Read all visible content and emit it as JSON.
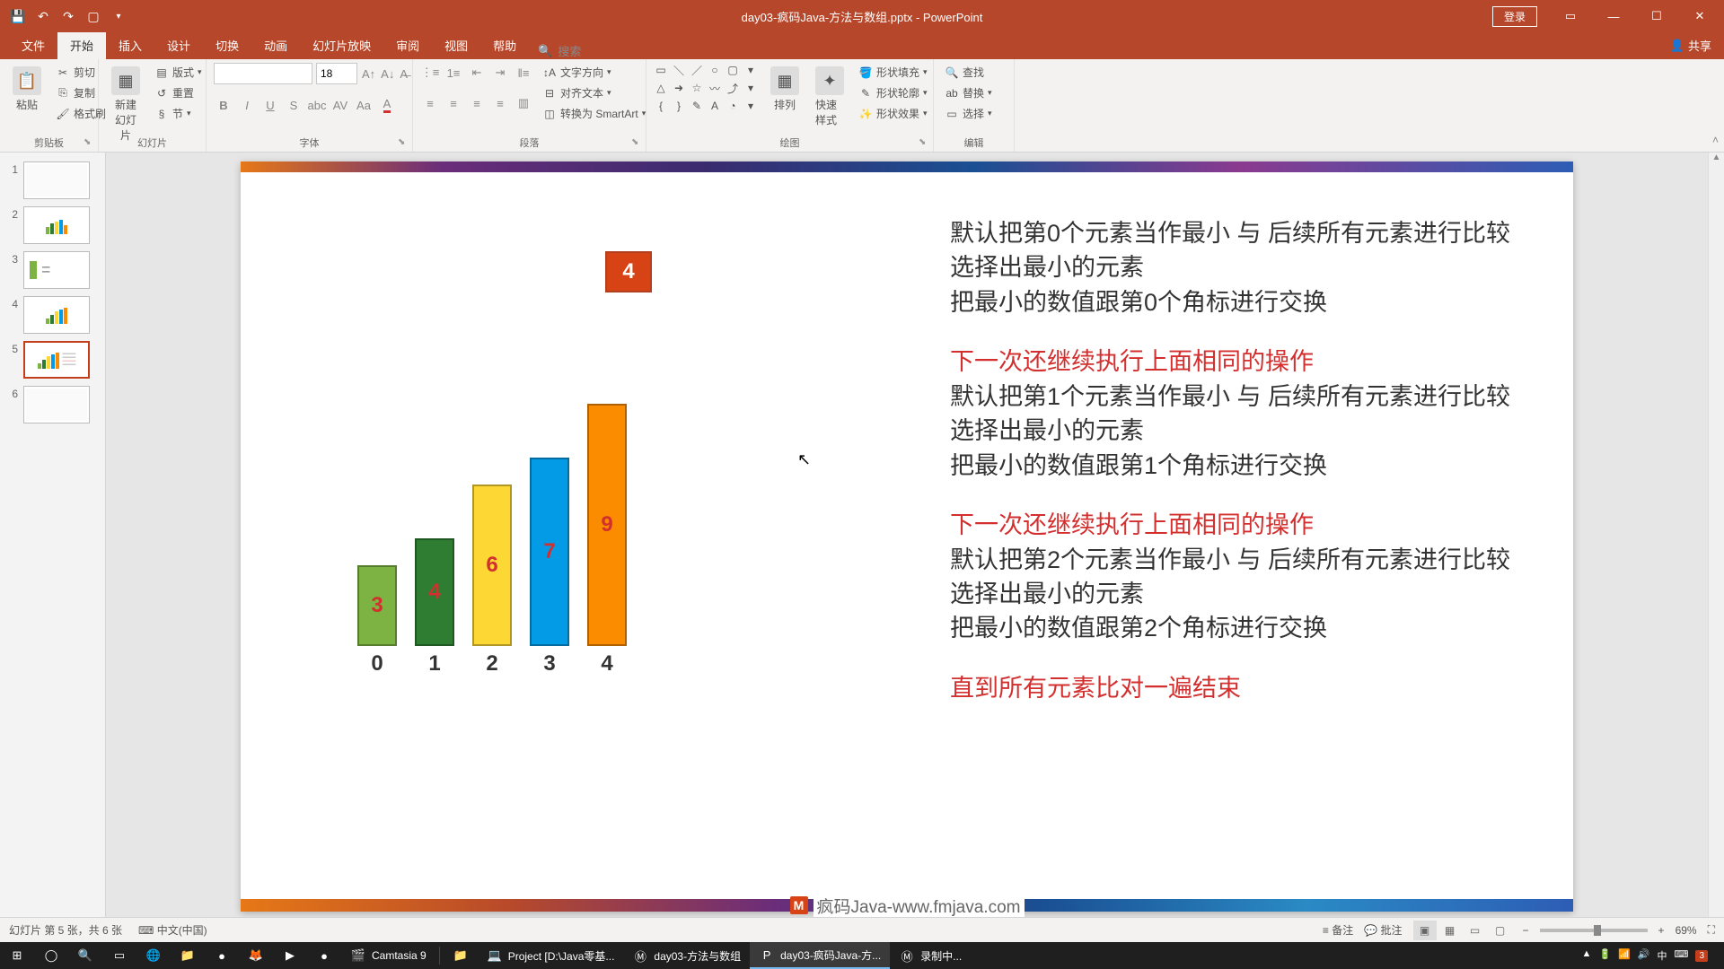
{
  "titlebar": {
    "doc_title": "day03-疯码Java-方法与数组.pptx - PowerPoint",
    "login": "登录"
  },
  "tabs": {
    "file": "文件",
    "home": "开始",
    "insert": "插入",
    "design": "设计",
    "transitions": "切换",
    "animations": "动画",
    "slideshow": "幻灯片放映",
    "review": "审阅",
    "view": "视图",
    "help": "帮助",
    "search": "搜索",
    "share": "共享"
  },
  "ribbon": {
    "clipboard": {
      "label": "剪贴板",
      "paste": "粘贴",
      "cut": "剪切",
      "copy": "复制",
      "format_painter": "格式刷"
    },
    "slides": {
      "label": "幻灯片",
      "new_slide": "新建\n幻灯片",
      "layout": "版式",
      "reset": "重置",
      "section": "节"
    },
    "font": {
      "label": "字体",
      "size": "18"
    },
    "paragraph": {
      "label": "段落",
      "text_direction": "文字方向",
      "align_text": "对齐文本",
      "smartart": "转换为 SmartArt"
    },
    "drawing": {
      "label": "绘图",
      "arrange": "排列",
      "quick_styles": "快速样式",
      "shape_fill": "形状填充",
      "shape_outline": "形状轮廓",
      "shape_effects": "形状效果"
    },
    "editing": {
      "label": "编辑",
      "find": "查找",
      "replace": "替换",
      "select": "选择"
    }
  },
  "thumbs": [
    {
      "n": "1"
    },
    {
      "n": "2"
    },
    {
      "n": "3"
    },
    {
      "n": "4"
    },
    {
      "n": "5"
    },
    {
      "n": "6"
    }
  ],
  "chart_data": {
    "type": "bar",
    "categories": [
      "0",
      "1",
      "2",
      "3",
      "4"
    ],
    "values": [
      3,
      4,
      6,
      7,
      9
    ],
    "colors": [
      "#7cb342",
      "#2e7d32",
      "#fdd835",
      "#039be5",
      "#fb8c00"
    ],
    "text_colors": [
      "#d32f2f",
      "#d32f2f",
      "#d32f2f",
      "#d32f2f",
      "#d32f2f"
    ],
    "float_value": "4",
    "xlabel": "",
    "ylabel": "",
    "ylim": [
      0,
      10
    ]
  },
  "slide_text": {
    "b1l1": "默认把第0个元素当作最小 与 后续所有元素进行比较",
    "b1l2": "选择出最小的元素",
    "b1l3": "把最小的数值跟第0个角标进行交换",
    "r1": "下一次还继续执行上面相同的操作",
    "b2l1": "默认把第1个元素当作最小 与 后续所有元素进行比较",
    "b2l2": "选择出最小的元素",
    "b2l3": "把最小的数值跟第1个角标进行交换",
    "r2": "下一次还继续执行上面相同的操作",
    "b3l1": "默认把第2个元素当作最小 与 后续所有元素进行比较",
    "b3l2": "选择出最小的元素",
    "b3l3": "把最小的数值跟第2个角标进行交换",
    "r3": "直到所有元素比对一遍结束"
  },
  "footer": {
    "brand": "疯码Java-www.fmjava.com"
  },
  "status": {
    "slide_info": "幻灯片 第 5 张，共 6 张",
    "lang": "中文(中国)",
    "notes": "备注",
    "comments": "批注",
    "zoom": "69%"
  },
  "taskbar": {
    "items": [
      {
        "icon": "⊞",
        "label": ""
      },
      {
        "icon": "◯",
        "label": ""
      },
      {
        "icon": "🔍",
        "label": ""
      },
      {
        "icon": "▭",
        "label": ""
      },
      {
        "icon": "🌐",
        "label": ""
      },
      {
        "icon": "📁",
        "label": ""
      },
      {
        "icon": "●",
        "label": ""
      },
      {
        "icon": "🦊",
        "label": ""
      },
      {
        "icon": "▶",
        "label": ""
      },
      {
        "icon": "●",
        "label": ""
      },
      {
        "icon": "🎬",
        "label": "Camtasia 9"
      }
    ],
    "apps": [
      {
        "icon": "📁",
        "label": ""
      },
      {
        "icon": "💻",
        "label": "Project [D:\\Java零基..."
      },
      {
        "icon": "Ⓜ",
        "label": "day03-方法与数组"
      },
      {
        "icon": "P",
        "label": "day03-疯码Java-方...",
        "active": true
      },
      {
        "icon": "Ⓜ",
        "label": "录制中..."
      }
    ],
    "time": "",
    "tray_icons": [
      "▲",
      "🔋",
      "📶",
      "🔊",
      "中",
      "⌨"
    ]
  }
}
